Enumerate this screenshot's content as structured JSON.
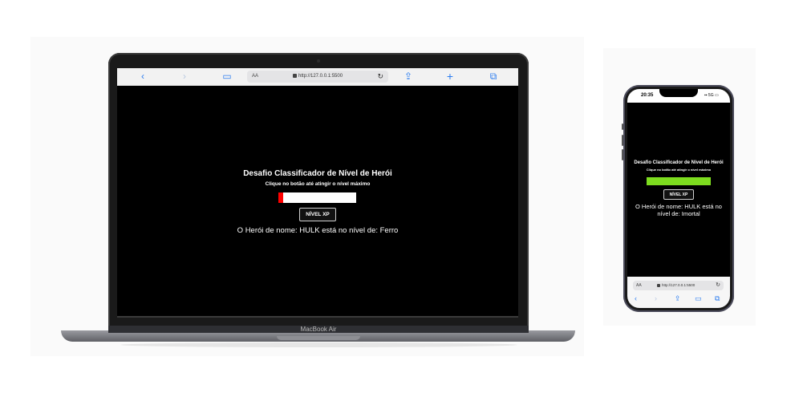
{
  "laptop": {
    "brand": "MacBook Air",
    "browser": {
      "url": "http://127.0.0.1:5500",
      "aa": "AA",
      "back": "‹",
      "forward": "›",
      "reader": "▭",
      "reload": "↻",
      "share": "⇪",
      "new_tab": "+",
      "tabs": "⧉"
    }
  },
  "phone": {
    "status": {
      "time": "20:35",
      "signal": "▪▪ 5G ▭"
    },
    "browser": {
      "url": "http://127.0.0.1:5500",
      "aa": "AA",
      "reload": "↻",
      "back": "‹",
      "forward": "›",
      "share": "⇪",
      "bookmarks": "▭",
      "tabs": "⧉"
    }
  },
  "app_desktop": {
    "title": "Desafio Classificador de Nível de Herói",
    "subtitle": "Clique no botão até atingir o nível máximo",
    "button_label": "NÍVEL XP",
    "result": "O Herói de nome: HULK está no nível de: Ferro",
    "progress": 0.06,
    "progress_color": "#ff0000"
  },
  "app_mobile": {
    "title": "Desafio Classificador de Nível de Herói",
    "subtitle": "Clique no botão até atingir o nível máximo",
    "button_label": "NÍVEL XP",
    "result_line1": "O Herói de nome: HULK está no",
    "result_line2": "nível de: Imortal",
    "progress": 1.0,
    "progress_color": "#7ddc1f"
  }
}
